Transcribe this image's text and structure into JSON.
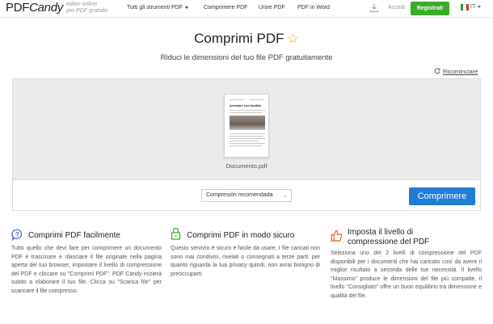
{
  "header": {
    "logo_main": "PDF",
    "logo_italic": "Candy",
    "tagline_1": "editor online",
    "tagline_2": "per PDF gratuito",
    "nav": [
      {
        "label": "Tutti gli strumenti PDF"
      },
      {
        "label": "Comprimere PDF"
      },
      {
        "label": "Unire PDF"
      },
      {
        "label": "PDF in Word"
      }
    ],
    "login_label": "Accedi",
    "register_label": "Registrati",
    "language_label": "IT"
  },
  "main": {
    "title": "Comprimi PDF",
    "subtitle": "Riduci le dimensioni del tuo file PDF gratuitamente",
    "restart_label": "Ricominciare"
  },
  "file": {
    "name": "Documento.pdf",
    "preview_heading": "Arredare con facilità"
  },
  "actions": {
    "compression_select": "Compresión recomendada",
    "compress_button": "Comprimere"
  },
  "features": [
    {
      "title": "Comprimi PDF facilmente",
      "icon": "question-bubble-icon",
      "text": "Tutto quello che devi fare per comprimere un documento PDF è trascinare e rilasciare il file originale nella pagina aperta del tuo browser, impostare il livello di compressione del PDF e cliccare su \"Comprimi PDF\". PDF Candy inizierà subito a elaborare il tuo file. Clicca su \"Scarica file\" per scaricare il file compresso."
    },
    {
      "title": "Comprimi PDF in modo sicuro",
      "icon": "lock-icon",
      "text": "Questo servizio è sicuro e facile da usare. I file caricati non sono mai condivisi, rivelati o consegnati a terze parti: per quanto riguarda la tua privacy quindi, non avrai bisogno di preoccuparti."
    },
    {
      "title": "Imposta il livello di compressione del PDF",
      "icon": "thumbs-up-icon",
      "text": "Seleziona uno dei 2 livelli di compressione del PDF disponibili per i documenti che hai caricato così da avere il miglior risultato a seconda delle tue necessità. Il livello \"Massimo\" produce le dimensioni del file più compatte, il livello \"Consigliato\" offre un buon equilibrio tra dimensione e qualità del file."
    }
  ],
  "colors": {
    "accent_blue": "#1f7dd6",
    "register_green": "#3bab2a",
    "star_yellow": "#f0b400",
    "feature_blue": "#4a5bd4",
    "feature_green": "#3bab2a",
    "feature_orange": "#e8572a"
  }
}
